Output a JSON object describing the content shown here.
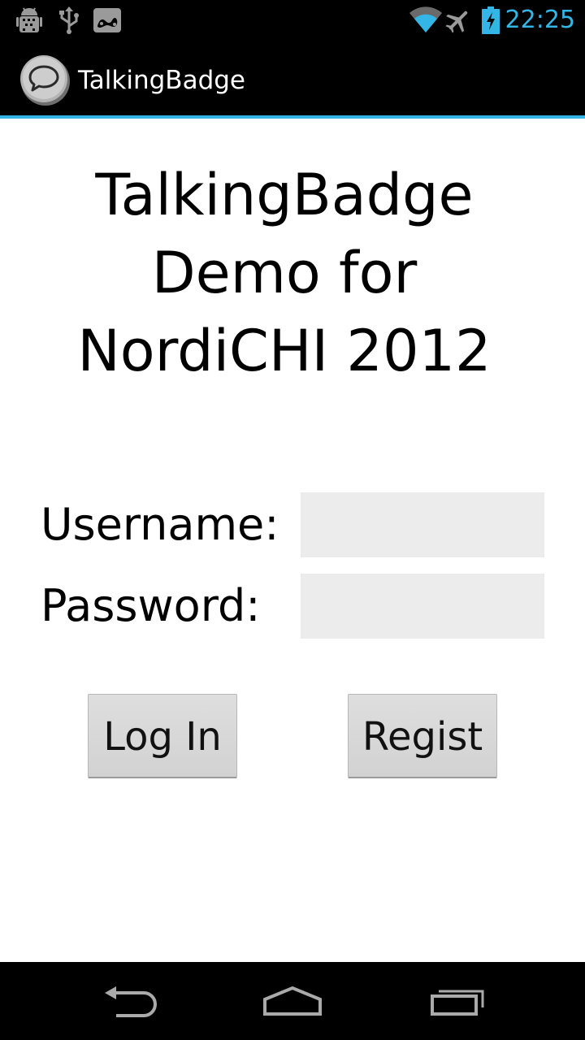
{
  "status_bar": {
    "time": "22:25",
    "left_icons": [
      "android-debug-icon",
      "usb-icon",
      "game-controller-icon"
    ],
    "right_icons": [
      "wifi-icon",
      "airplane-mode-icon",
      "battery-charging-icon"
    ],
    "accent_color": "#33b5e5"
  },
  "action_bar": {
    "title": "TalkingBadge",
    "icon": "chat-bubble-icon"
  },
  "headline": {
    "line1": "TalkingBadge",
    "line2": "Demo for",
    "line3": "NordiCHI 2012"
  },
  "form": {
    "username_label": "Username:",
    "username_value": "",
    "password_label": "Password:",
    "password_value": ""
  },
  "buttons": {
    "login_label": "Log In",
    "register_label": "Regist"
  },
  "nav_bar": {
    "icons": [
      "back-icon",
      "home-icon",
      "recent-apps-icon"
    ]
  }
}
